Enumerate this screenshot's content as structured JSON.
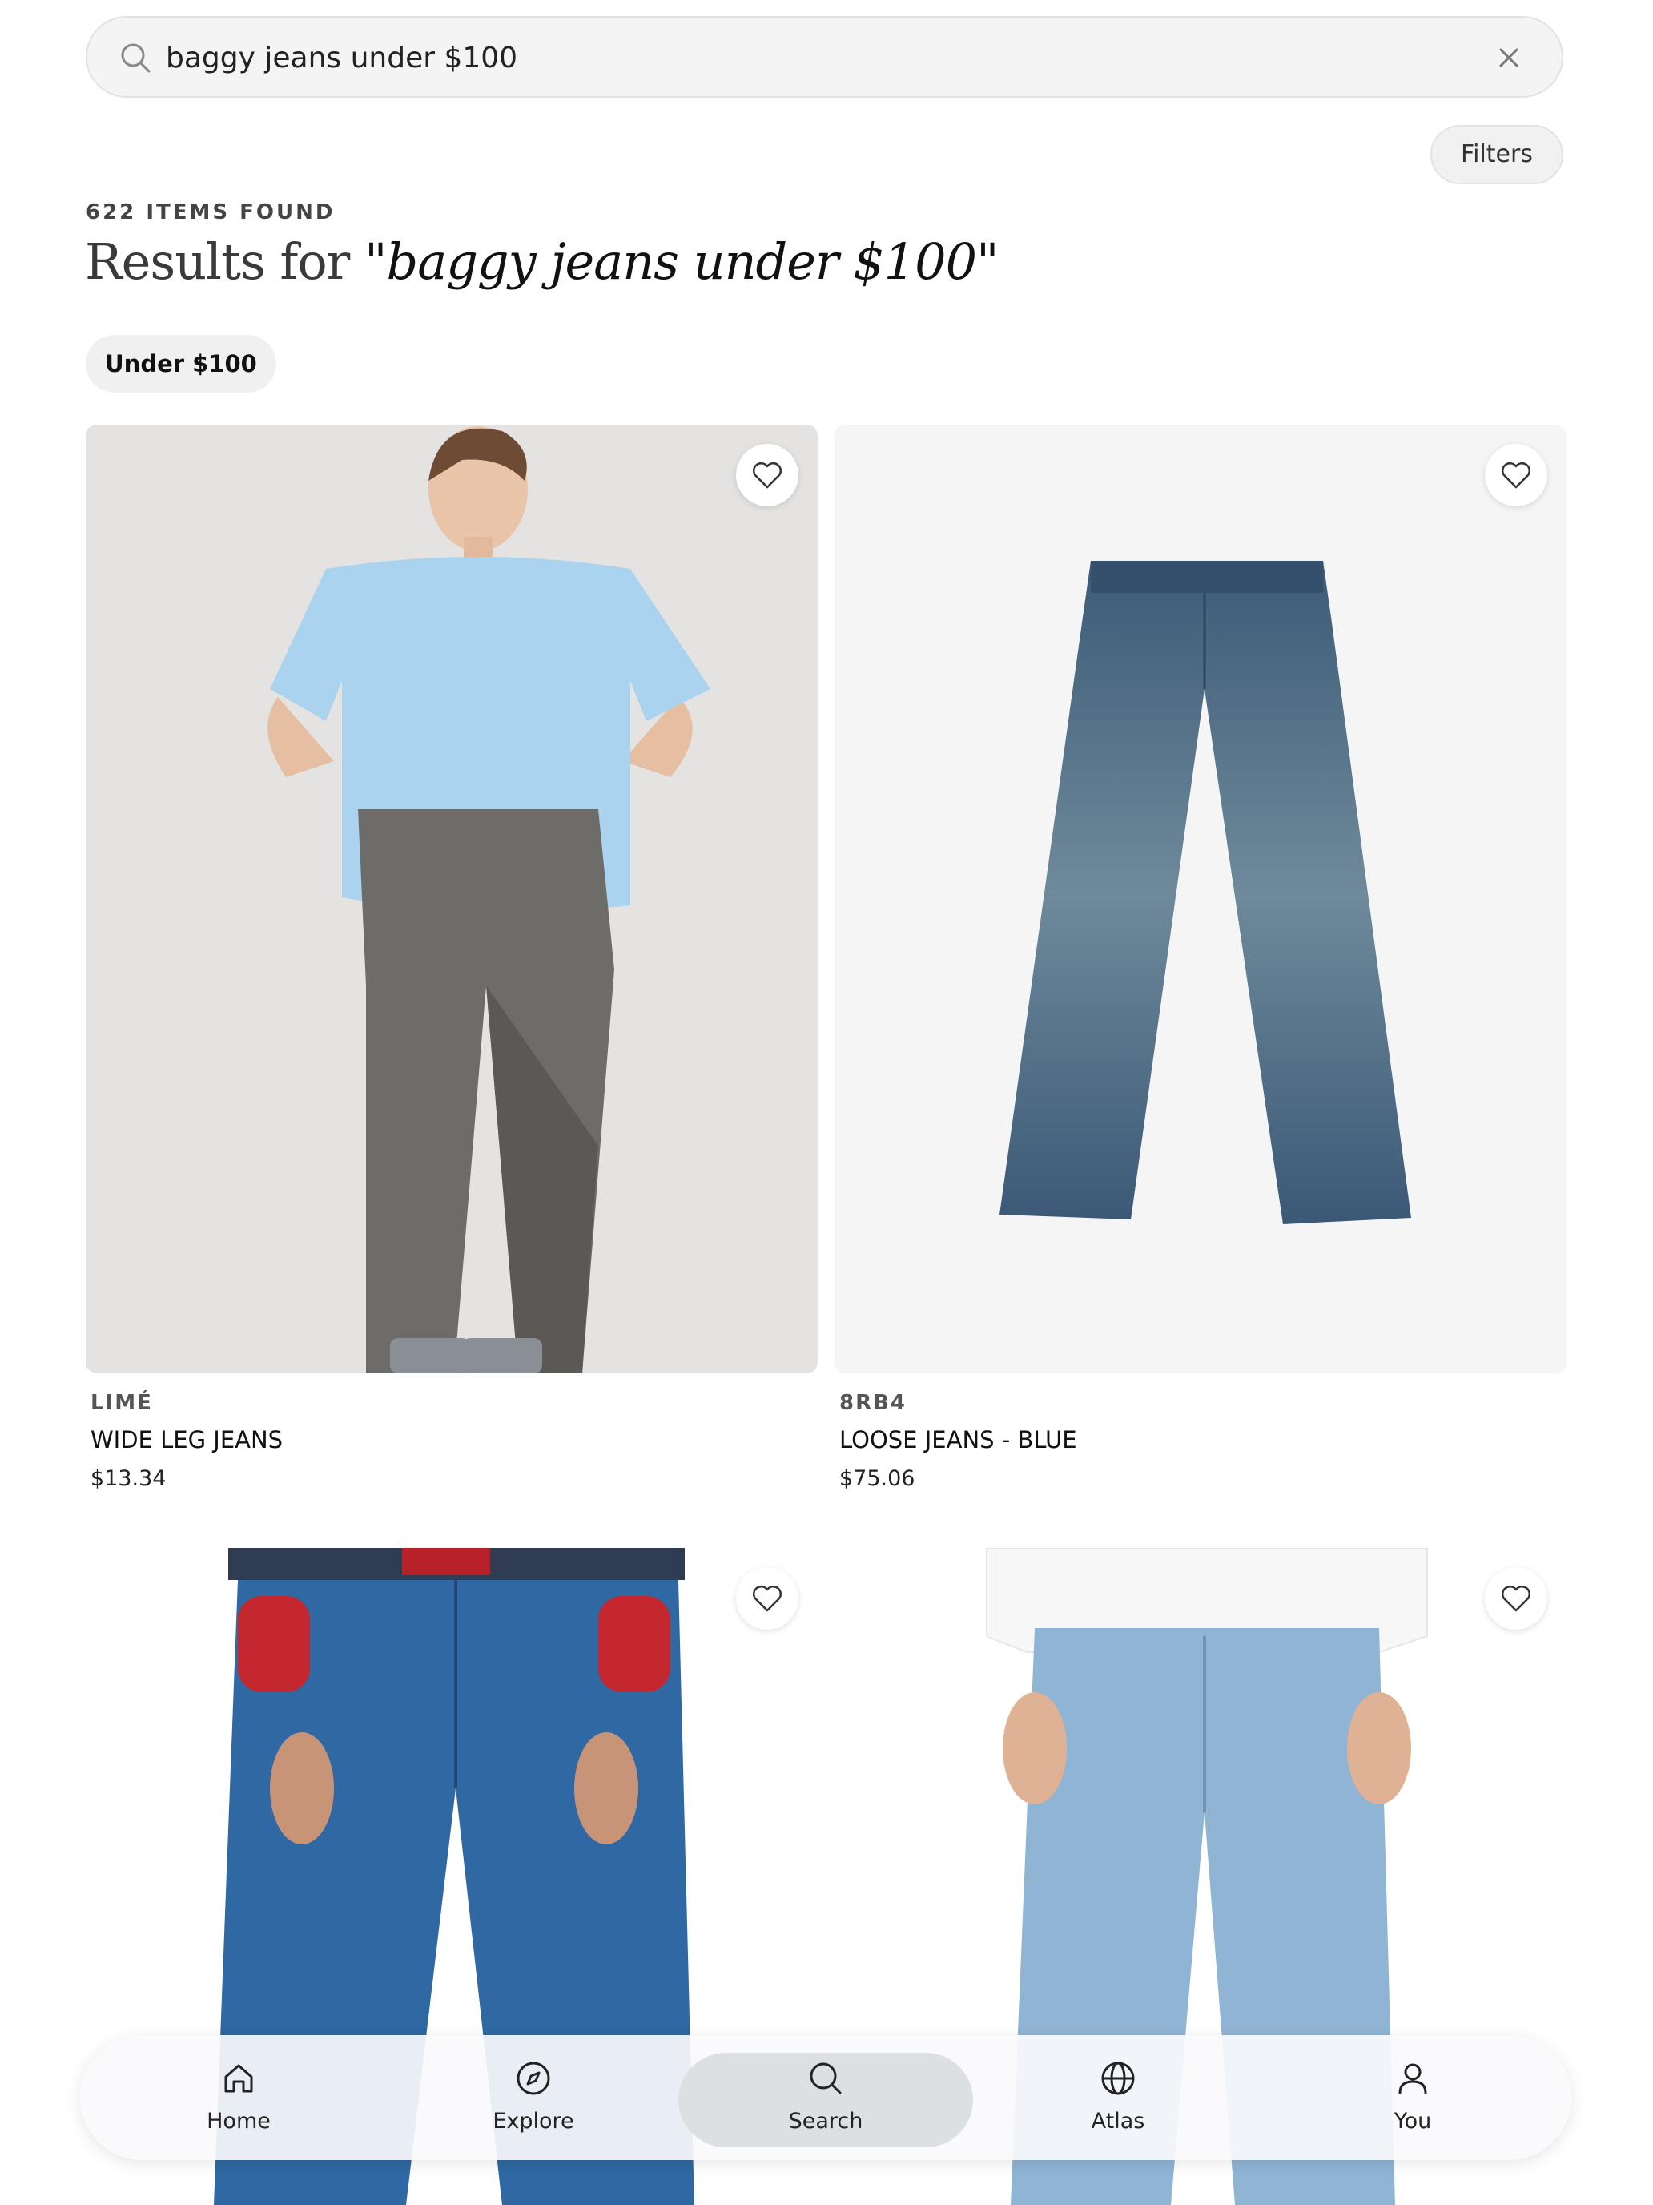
{
  "search": {
    "query": "baggy jeans under $100"
  },
  "filters_label": "Filters",
  "results": {
    "count_label": "622 ITEMS FOUND",
    "title_prefix": "Results for",
    "title_query": "\"baggy jeans under $100\""
  },
  "active_chip": "Under $100",
  "products": [
    {
      "brand": "LIMÉ",
      "name": "WIDE LEG JEANS",
      "price": "$13.34"
    },
    {
      "brand": "8RB4",
      "name": "LOOSE JEANS - BLUE",
      "price": "$75.06"
    },
    {
      "brand": "",
      "name": "",
      "price": ""
    },
    {
      "brand": "",
      "name": "",
      "price": ""
    }
  ],
  "nav": [
    {
      "label": "Home",
      "icon": "home-icon"
    },
    {
      "label": "Explore",
      "icon": "compass-icon"
    },
    {
      "label": "Search",
      "icon": "search-icon",
      "active": true
    },
    {
      "label": "Atlas",
      "icon": "globe-icon"
    },
    {
      "label": "You",
      "icon": "user-icon"
    }
  ]
}
